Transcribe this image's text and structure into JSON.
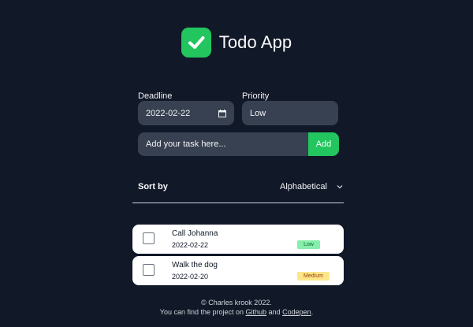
{
  "header": {
    "title": "Todo App",
    "logo_icon": "check-icon",
    "accent": "#22c55e"
  },
  "form": {
    "deadline_label": "Deadline",
    "deadline_value": "2022-02-22",
    "priority_label": "Priority",
    "priority_value": "Low",
    "task_placeholder": "Add your task here...",
    "add_label": "Add"
  },
  "sort": {
    "label": "Sort by",
    "selected": "Alphabetical"
  },
  "todos": [
    {
      "title": "Call Johanna",
      "date": "2022-02-22",
      "priority": "Low",
      "checked": false
    },
    {
      "title": "Walk the dog",
      "date": "2022-02-20",
      "priority": "Medium",
      "checked": false
    }
  ],
  "footer": {
    "copyright": "© Charles krook 2022.",
    "prefix": "You can find the project on",
    "github": "Github",
    "and": "and",
    "codepen": "Codepen",
    "suffix": "."
  },
  "colors": {
    "background": "#111827",
    "field": "#374151",
    "low_badge": "#86efac",
    "medium_badge": "#fde68a"
  }
}
